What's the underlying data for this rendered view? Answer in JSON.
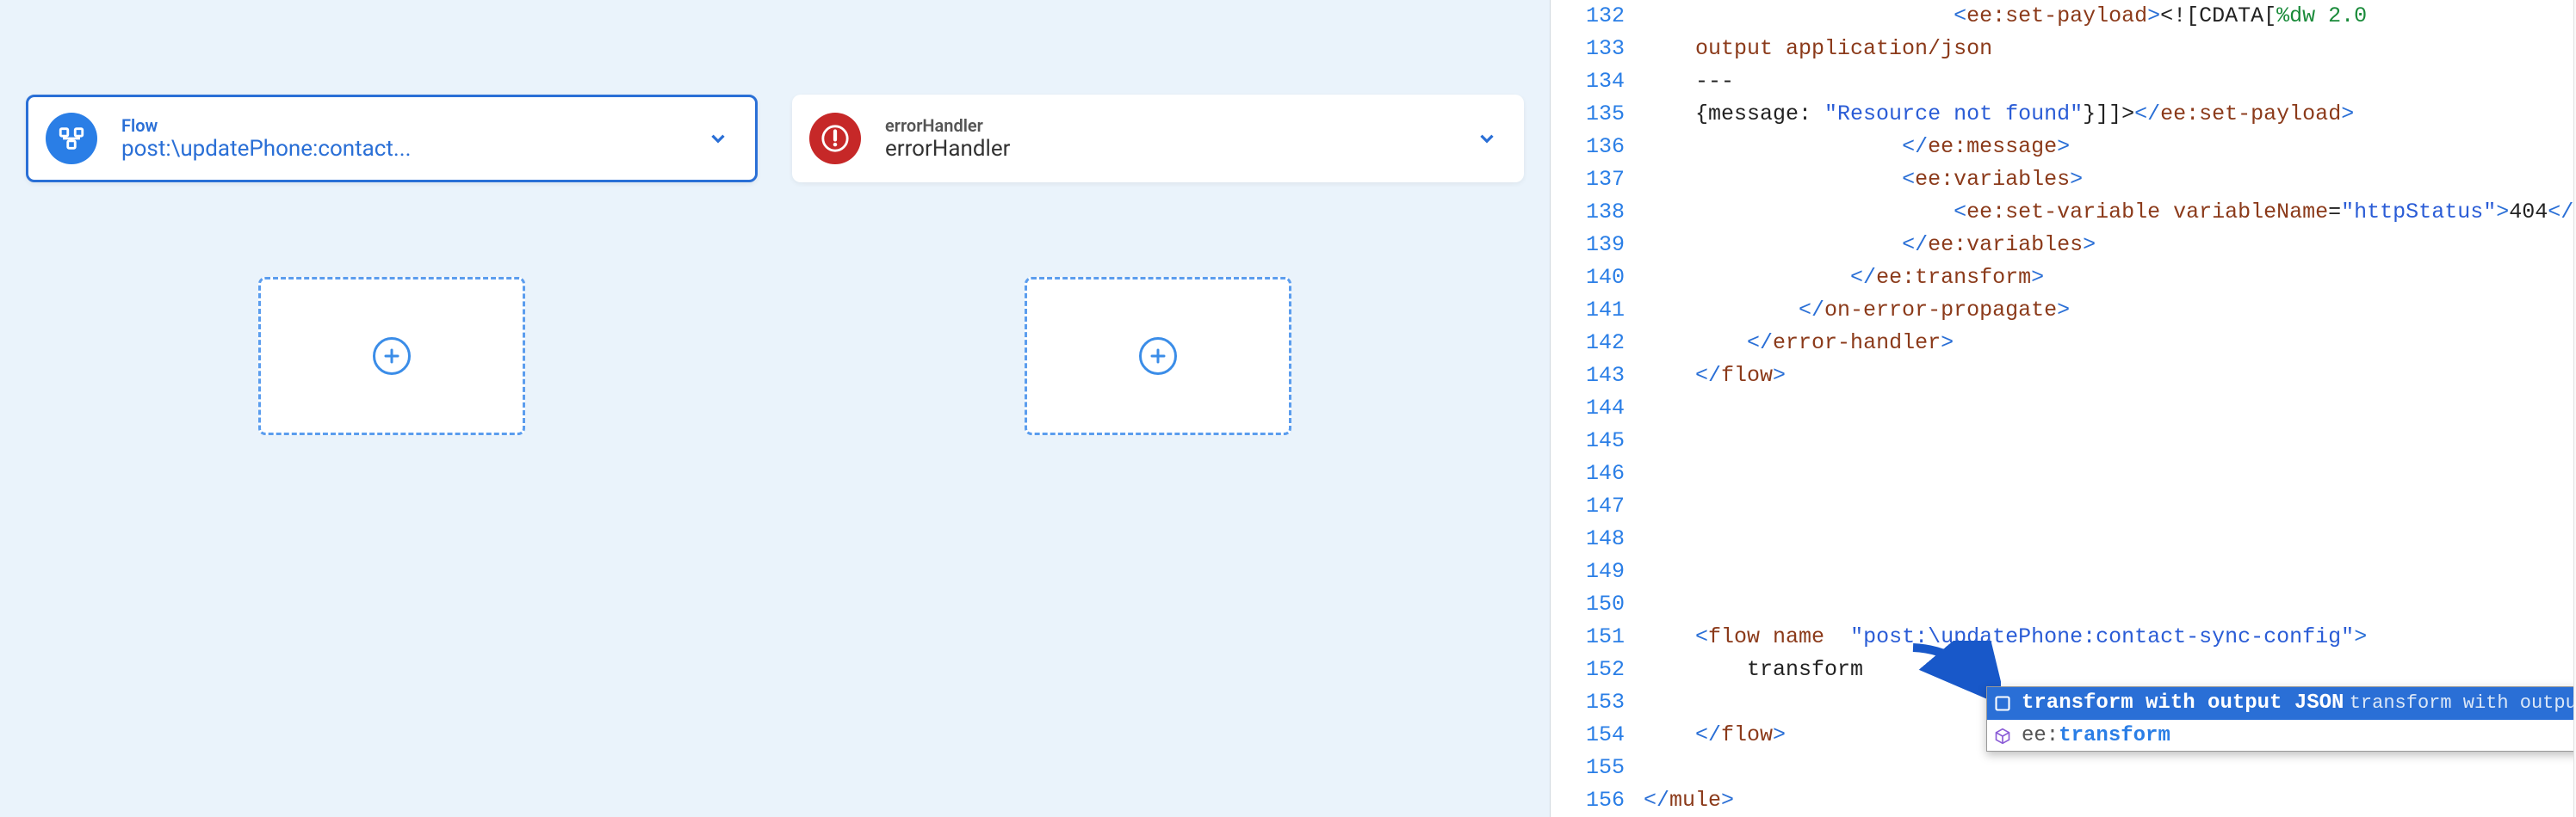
{
  "leftPane": {
    "cards": [
      {
        "type": "Flow",
        "name": "post:\\updatePhone:contact...",
        "iconName": "flow-icon"
      },
      {
        "type": "errorHandler",
        "name": "errorHandler",
        "iconName": "error-icon"
      }
    ]
  },
  "editor": {
    "startLine": 132,
    "lines": [
      {
        "n": 132,
        "indent": 5,
        "segments": [
          {
            "t": "<",
            "c": "c-tag"
          },
          {
            "t": "ee:set-payload",
            "c": "c-brown"
          },
          {
            "t": ">",
            "c": "c-tag"
          },
          {
            "t": "<![CDATA[",
            "c": "c-text"
          },
          {
            "t": "%dw 2.0",
            "c": "c-num"
          }
        ]
      },
      {
        "n": 133,
        "indent": 0,
        "segments": [
          {
            "t": "output application/json",
            "c": "c-brown"
          }
        ]
      },
      {
        "n": 134,
        "indent": 0,
        "segments": [
          {
            "t": "---",
            "c": "c-text"
          }
        ]
      },
      {
        "n": 135,
        "indent": 0,
        "segments": [
          {
            "t": "{message: ",
            "c": "c-text"
          },
          {
            "t": "\"Resource not found\"",
            "c": "c-val"
          },
          {
            "t": "}",
            "c": "c-text"
          },
          {
            "t": "]]>",
            "c": "c-text"
          },
          {
            "t": "</",
            "c": "c-tag"
          },
          {
            "t": "ee:set-payload",
            "c": "c-brown"
          },
          {
            "t": ">",
            "c": "c-tag"
          }
        ]
      },
      {
        "n": 136,
        "indent": 4,
        "segments": [
          {
            "t": "</",
            "c": "c-tag"
          },
          {
            "t": "ee:message",
            "c": "c-brown"
          },
          {
            "t": ">",
            "c": "c-tag"
          }
        ]
      },
      {
        "n": 137,
        "indent": 4,
        "segments": [
          {
            "t": "<",
            "c": "c-tag"
          },
          {
            "t": "ee:variables",
            "c": "c-brown"
          },
          {
            "t": ">",
            "c": "c-tag"
          }
        ]
      },
      {
        "n": 138,
        "indent": 5,
        "segments": [
          {
            "t": "<",
            "c": "c-tag"
          },
          {
            "t": "ee:set-variable ",
            "c": "c-brown"
          },
          {
            "t": "variableName",
            "c": "c-attr"
          },
          {
            "t": "=",
            "c": "c-text"
          },
          {
            "t": "\"httpStatus\"",
            "c": "c-val"
          },
          {
            "t": ">",
            "c": "c-tag"
          },
          {
            "t": "404",
            "c": "c-text"
          },
          {
            "t": "</",
            "c": "c-tag"
          }
        ]
      },
      {
        "n": 139,
        "indent": 4,
        "segments": [
          {
            "t": "</",
            "c": "c-tag"
          },
          {
            "t": "ee:variables",
            "c": "c-brown"
          },
          {
            "t": ">",
            "c": "c-tag"
          }
        ]
      },
      {
        "n": 140,
        "indent": 3,
        "segments": [
          {
            "t": "</",
            "c": "c-tag"
          },
          {
            "t": "ee:transform",
            "c": "c-brown"
          },
          {
            "t": ">",
            "c": "c-tag"
          }
        ]
      },
      {
        "n": 141,
        "indent": 2,
        "segments": [
          {
            "t": "</",
            "c": "c-tag"
          },
          {
            "t": "on-error-propagate",
            "c": "c-brown"
          },
          {
            "t": ">",
            "c": "c-tag"
          }
        ]
      },
      {
        "n": 142,
        "indent": 1,
        "segments": [
          {
            "t": "</",
            "c": "c-tag"
          },
          {
            "t": "error-handler",
            "c": "c-brown"
          },
          {
            "t": ">",
            "c": "c-tag"
          }
        ]
      },
      {
        "n": 143,
        "indent": 0,
        "segments": [
          {
            "t": "</",
            "c": "c-tag"
          },
          {
            "t": "flow",
            "c": "c-brown"
          },
          {
            "t": ">",
            "c": "c-tag"
          }
        ]
      },
      {
        "n": 144,
        "indent": 0,
        "segments": []
      },
      {
        "n": 145,
        "indent": 0,
        "segments": []
      },
      {
        "n": 146,
        "indent": 0,
        "segments": []
      },
      {
        "n": 147,
        "indent": 0,
        "segments": []
      },
      {
        "n": 148,
        "indent": 0,
        "segments": []
      },
      {
        "n": 149,
        "indent": 0,
        "segments": []
      },
      {
        "n": 150,
        "indent": 0,
        "segments": []
      },
      {
        "n": 151,
        "indent": 0,
        "segments": [
          {
            "t": "<",
            "c": "c-tag"
          },
          {
            "t": "flow ",
            "c": "c-brown"
          },
          {
            "t": "name",
            "c": "c-attr"
          },
          {
            "t": "  ",
            "c": "c-text"
          },
          {
            "t": "\"post:\\updatePhone:contact-sync-config\"",
            "c": "c-val"
          },
          {
            "t": ">",
            "c": "c-tag"
          }
        ]
      },
      {
        "n": 152,
        "indent": 1,
        "segments": [
          {
            "t": "transform",
            "c": "c-text"
          }
        ]
      },
      {
        "n": 153,
        "indent": 0,
        "segments": []
      },
      {
        "n": 154,
        "indent": 0,
        "segments": [
          {
            "t": "</",
            "c": "c-tag"
          },
          {
            "t": "flow",
            "c": "c-brown"
          },
          {
            "t": ">",
            "c": "c-tag"
          }
        ]
      },
      {
        "n": 155,
        "indent": 0,
        "segments": []
      },
      {
        "n": 156,
        "indent": -1,
        "segments": [
          {
            "t": "</",
            "c": "c-tag"
          },
          {
            "t": "mule",
            "c": "c-brown"
          },
          {
            "t": ">",
            "c": "c-tag"
          }
        ]
      }
    ],
    "autocomplete": {
      "items": [
        {
          "label": "transform with output JSON",
          "hint": "transform with output JSON",
          "selected": true,
          "icon": "snippet-icon"
        },
        {
          "prefix": "ee:",
          "label": "transform",
          "hint": "",
          "selected": false,
          "icon": "cube-icon"
        }
      ]
    }
  },
  "minimapLines": [
    {
      "w": 55,
      "c": "#a55"
    },
    {
      "w": 48,
      "c": "#a55"
    },
    {
      "w": 20,
      "c": "#888"
    },
    {
      "w": 62,
      "c": "#55a"
    },
    {
      "w": 40,
      "c": "#a55"
    },
    {
      "w": 42,
      "c": "#a55"
    },
    {
      "w": 60,
      "c": "#55a"
    },
    {
      "w": 40,
      "c": "#a55"
    },
    {
      "w": 38,
      "c": "#a55"
    },
    {
      "w": 44,
      "c": "#a55"
    },
    {
      "w": 36,
      "c": "#a55"
    },
    {
      "w": 30,
      "c": "#a55"
    },
    {
      "w": 0,
      "c": ""
    },
    {
      "w": 0,
      "c": ""
    },
    {
      "w": 0,
      "c": ""
    },
    {
      "w": 0,
      "c": ""
    },
    {
      "w": 0,
      "c": ""
    },
    {
      "w": 58,
      "c": "#55a"
    },
    {
      "w": 26,
      "c": "#888"
    },
    {
      "w": 0,
      "c": ""
    },
    {
      "w": 24,
      "c": "#a55"
    },
    {
      "w": 0,
      "c": ""
    },
    {
      "w": 20,
      "c": "#a55"
    },
    {
      "w": 50,
      "c": "#a55"
    },
    {
      "w": 52,
      "c": "#55a"
    },
    {
      "w": 48,
      "c": "#a55"
    },
    {
      "w": 46,
      "c": "#a55"
    },
    {
      "w": 54,
      "c": "#55a"
    },
    {
      "w": 44,
      "c": "#a55"
    },
    {
      "w": 50,
      "c": "#a55"
    },
    {
      "w": 40,
      "c": "#a55"
    },
    {
      "w": 58,
      "c": "#55a"
    },
    {
      "w": 42,
      "c": "#a55"
    },
    {
      "w": 48,
      "c": "#a55"
    },
    {
      "w": 46,
      "c": "#a55"
    },
    {
      "w": 52,
      "c": "#55a"
    },
    {
      "w": 40,
      "c": "#a55"
    },
    {
      "w": 44,
      "c": "#a55"
    },
    {
      "w": 50,
      "c": "#a55"
    },
    {
      "w": 38,
      "c": "#a55"
    }
  ]
}
